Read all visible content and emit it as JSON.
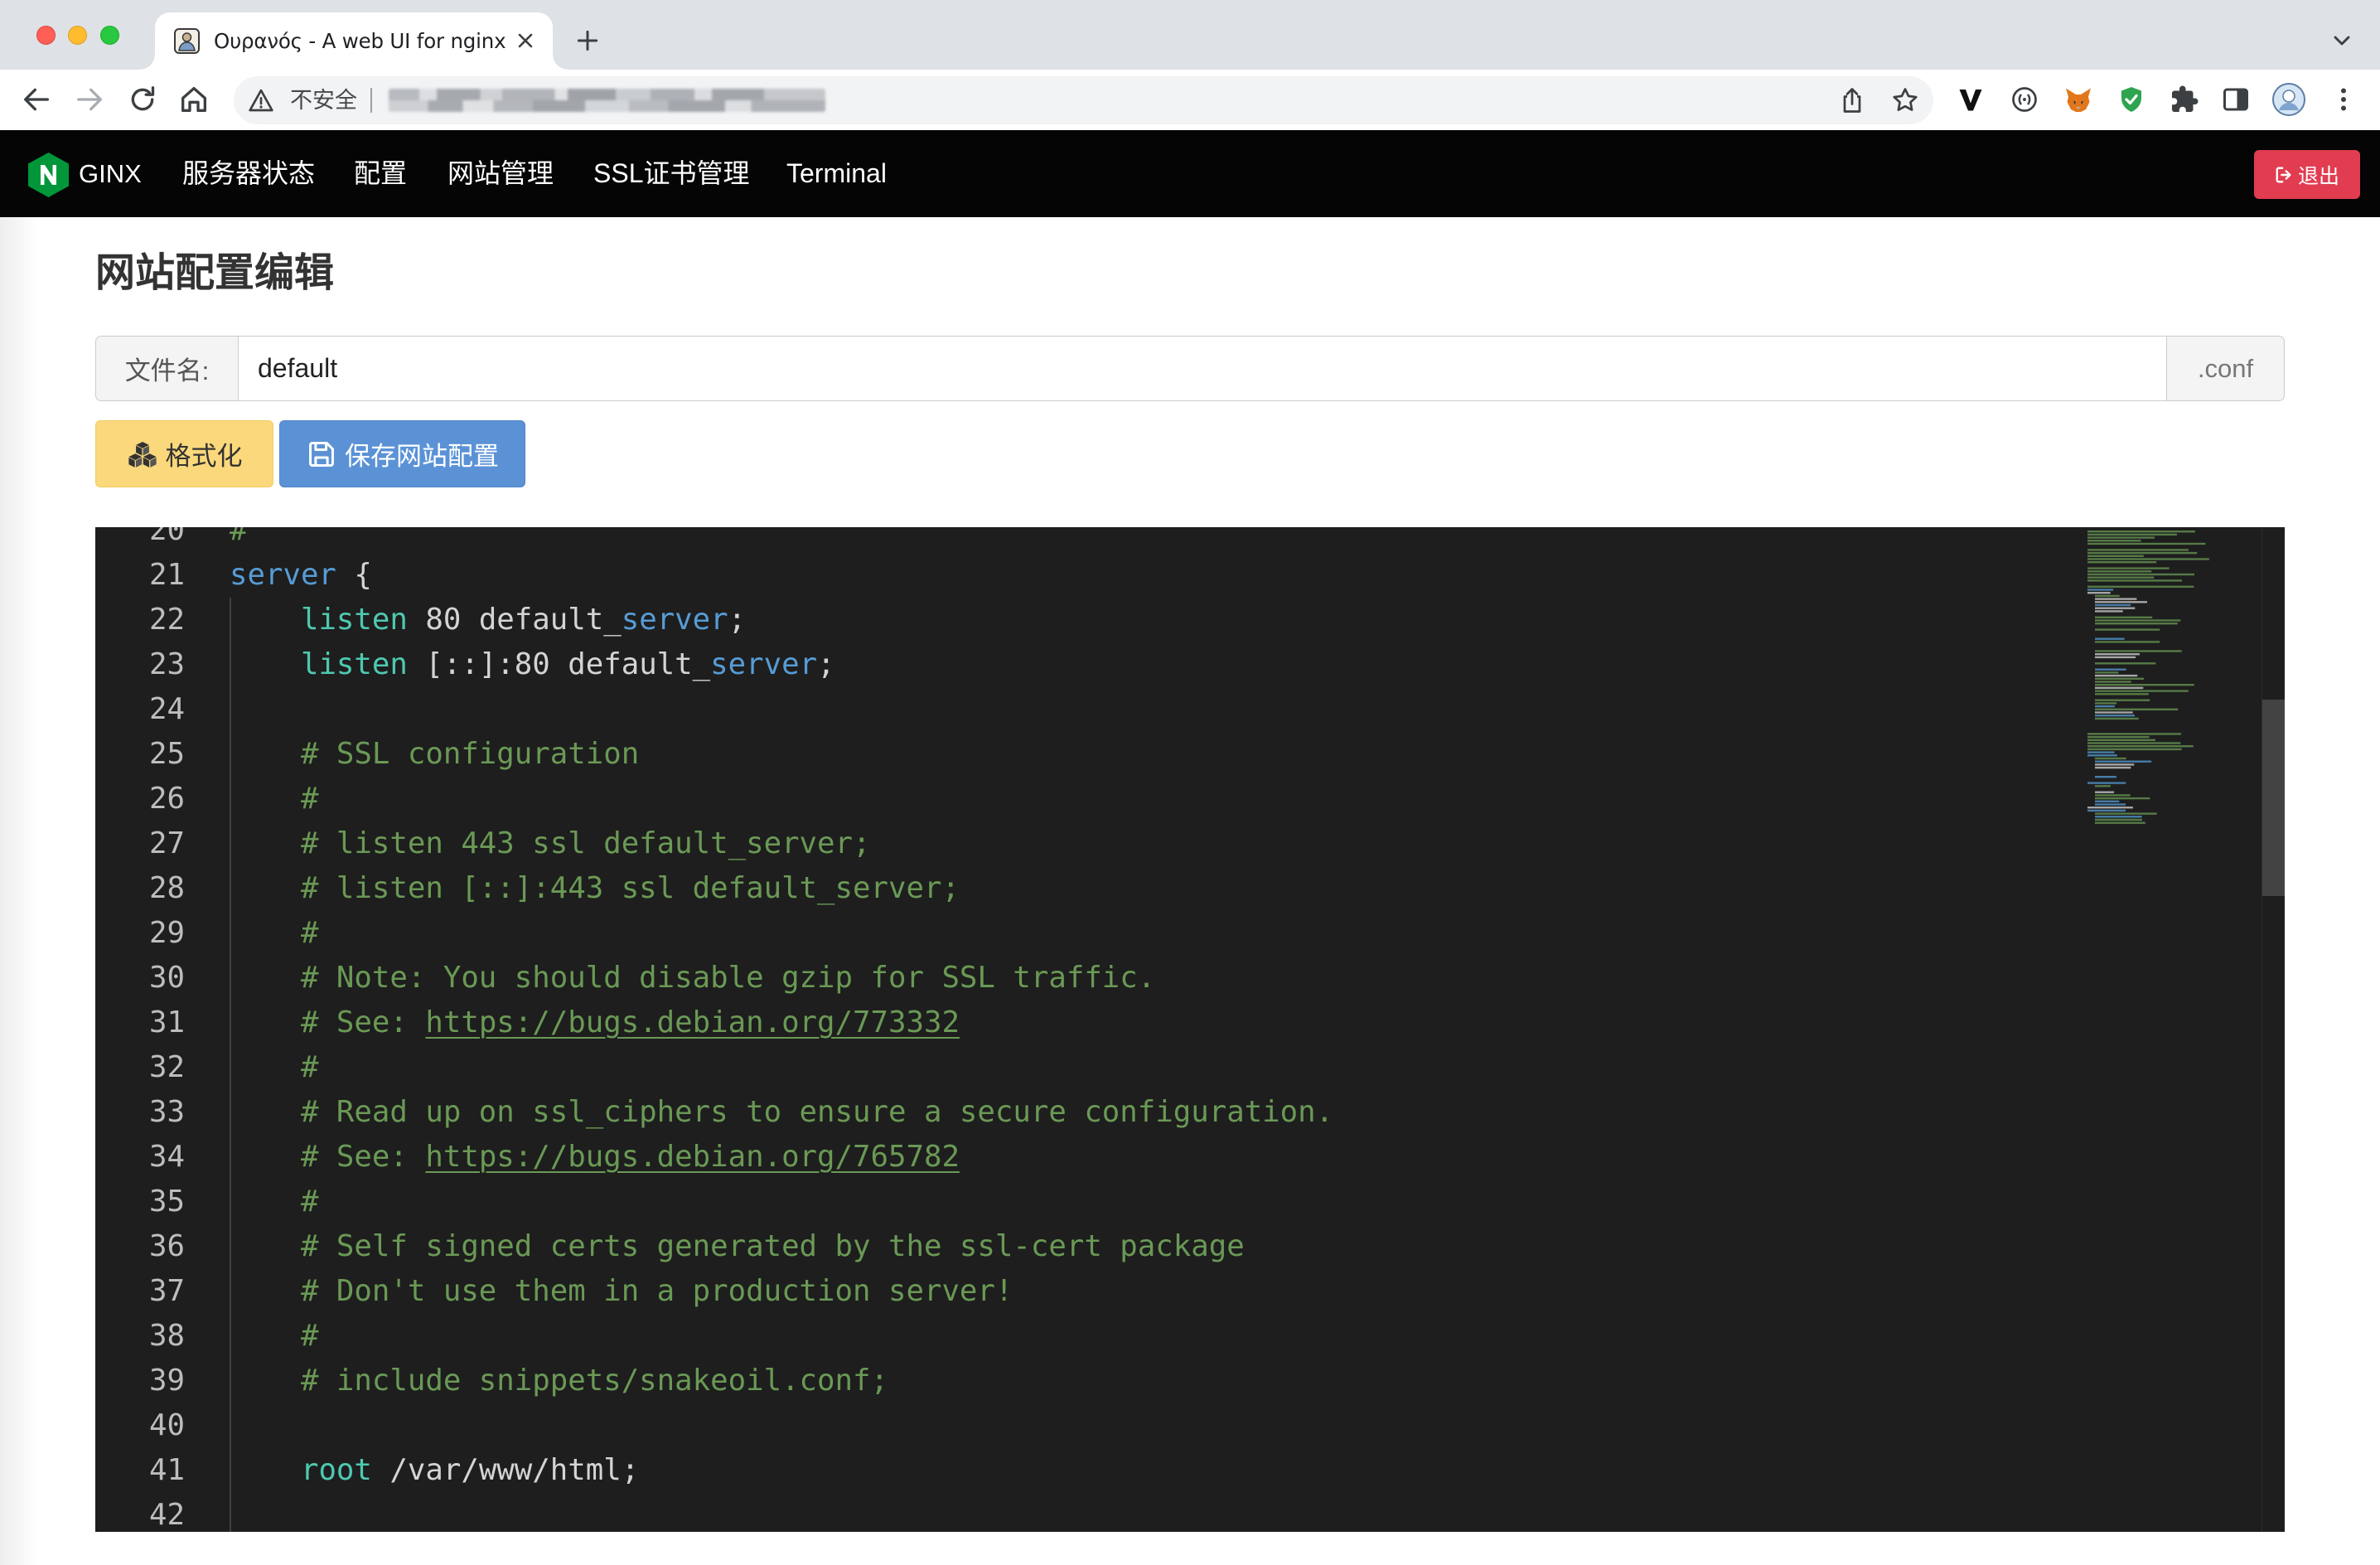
{
  "browser": {
    "tab_title": "Ουρανός - A web UI for nginx",
    "security_label": "不安全",
    "icons": {
      "traffic_lights": [
        "close-window-icon",
        "minimize-window-icon",
        "zoom-window-icon"
      ],
      "favicon": "site-favicon-icon",
      "tab_close": "close-icon",
      "new_tab": "plus-icon",
      "tab_menu": "chevron-down-icon",
      "back": "back-arrow-icon",
      "forward": "forward-arrow-icon",
      "reload": "reload-icon",
      "home": "home-icon",
      "security": "warning-triangle-icon",
      "share": "share-icon",
      "bookmark": "star-icon",
      "extensions": [
        "v-logo-icon",
        "circle-extension-icon",
        "fox-extension-icon",
        "shield-check-icon",
        "puzzle-icon",
        "side-panel-icon"
      ],
      "profile": "profile-avatar-icon",
      "menu": "menu-dots-icon"
    }
  },
  "navbar": {
    "logo": {
      "letter": "N",
      "icon": "nginx-hexagon-logo"
    },
    "brand": "GINX",
    "items": [
      {
        "label": "服务器状态"
      },
      {
        "label": "配置"
      },
      {
        "label": "网站管理"
      },
      {
        "label": "SSL证书管理"
      },
      {
        "label": "Terminal"
      }
    ],
    "logout_label": "退出",
    "logout_icon": "sign-out-icon"
  },
  "page": {
    "title": "网站配置编辑",
    "filename": {
      "label": "文件名:",
      "value": "default",
      "suffix": ".conf"
    },
    "buttons": {
      "format": "格式化",
      "format_icon": "cubes-icon",
      "save": "保存网站配置",
      "save_icon": "floppy-disk-icon"
    }
  },
  "editor": {
    "lines": [
      {
        "n": 20,
        "tokens": [
          {
            "comment": "#"
          }
        ]
      },
      {
        "n": 21,
        "tokens": [
          {
            "keyword": "server"
          },
          {
            "plain": " {"
          }
        ]
      },
      {
        "n": 22,
        "tokens": [
          {
            "plain": "    "
          },
          {
            "directive": "listen"
          },
          {
            "plain": " 80 default_"
          },
          {
            "keyword": "server"
          },
          {
            "plain": ";"
          }
        ]
      },
      {
        "n": 23,
        "tokens": [
          {
            "plain": "    "
          },
          {
            "directive": "listen"
          },
          {
            "plain": " [::]:80 default_"
          },
          {
            "keyword": "server"
          },
          {
            "plain": ";"
          }
        ]
      },
      {
        "n": 24,
        "tokens": []
      },
      {
        "n": 25,
        "tokens": [
          {
            "plain": "    "
          },
          {
            "comment": "# SSL configuration"
          }
        ]
      },
      {
        "n": 26,
        "tokens": [
          {
            "plain": "    "
          },
          {
            "comment": "#"
          }
        ]
      },
      {
        "n": 27,
        "tokens": [
          {
            "plain": "    "
          },
          {
            "comment": "# listen 443 ssl default_server;"
          }
        ]
      },
      {
        "n": 28,
        "tokens": [
          {
            "plain": "    "
          },
          {
            "comment": "# listen [::]:443 ssl default_server;"
          }
        ]
      },
      {
        "n": 29,
        "tokens": [
          {
            "plain": "    "
          },
          {
            "comment": "#"
          }
        ]
      },
      {
        "n": 30,
        "tokens": [
          {
            "plain": "    "
          },
          {
            "comment": "# Note: You should disable gzip for SSL traffic."
          }
        ]
      },
      {
        "n": 31,
        "tokens": [
          {
            "plain": "    "
          },
          {
            "comment": "# See: "
          },
          {
            "link": "https://bugs.debian.org/773332"
          }
        ]
      },
      {
        "n": 32,
        "tokens": [
          {
            "plain": "    "
          },
          {
            "comment": "#"
          }
        ]
      },
      {
        "n": 33,
        "tokens": [
          {
            "plain": "    "
          },
          {
            "comment": "# Read up on ssl_ciphers to ensure a secure configuration."
          }
        ]
      },
      {
        "n": 34,
        "tokens": [
          {
            "plain": "    "
          },
          {
            "comment": "# See: "
          },
          {
            "link": "https://bugs.debian.org/765782"
          }
        ]
      },
      {
        "n": 35,
        "tokens": [
          {
            "plain": "    "
          },
          {
            "comment": "#"
          }
        ]
      },
      {
        "n": 36,
        "tokens": [
          {
            "plain": "    "
          },
          {
            "comment": "# Self signed certs generated by the ssl-cert package"
          }
        ]
      },
      {
        "n": 37,
        "tokens": [
          {
            "plain": "    "
          },
          {
            "comment": "# Don't use them in a production server!"
          }
        ]
      },
      {
        "n": 38,
        "tokens": [
          {
            "plain": "    "
          },
          {
            "comment": "#"
          }
        ]
      },
      {
        "n": 39,
        "tokens": [
          {
            "plain": "    "
          },
          {
            "comment": "# include snippets/snakeoil.conf;"
          }
        ]
      },
      {
        "n": 40,
        "tokens": []
      },
      {
        "n": 41,
        "tokens": [
          {
            "plain": "    "
          },
          {
            "directive": "root"
          },
          {
            "plain": " /var/www/html;"
          }
        ]
      },
      {
        "n": 42,
        "tokens": []
      }
    ]
  },
  "colors": {
    "navbar_bg": "#050505",
    "logout_bg": "#e13c50",
    "format_bg": "#fbd87b",
    "save_bg": "#5b92d6",
    "editor_bg": "#1e1e1e",
    "keyword": "#569cd6",
    "directive": "#4ec9b0",
    "comment": "#6a9955",
    "plain": "#d4d4d4",
    "line_number": "#bdbdbd",
    "logo_green": "#009639"
  }
}
